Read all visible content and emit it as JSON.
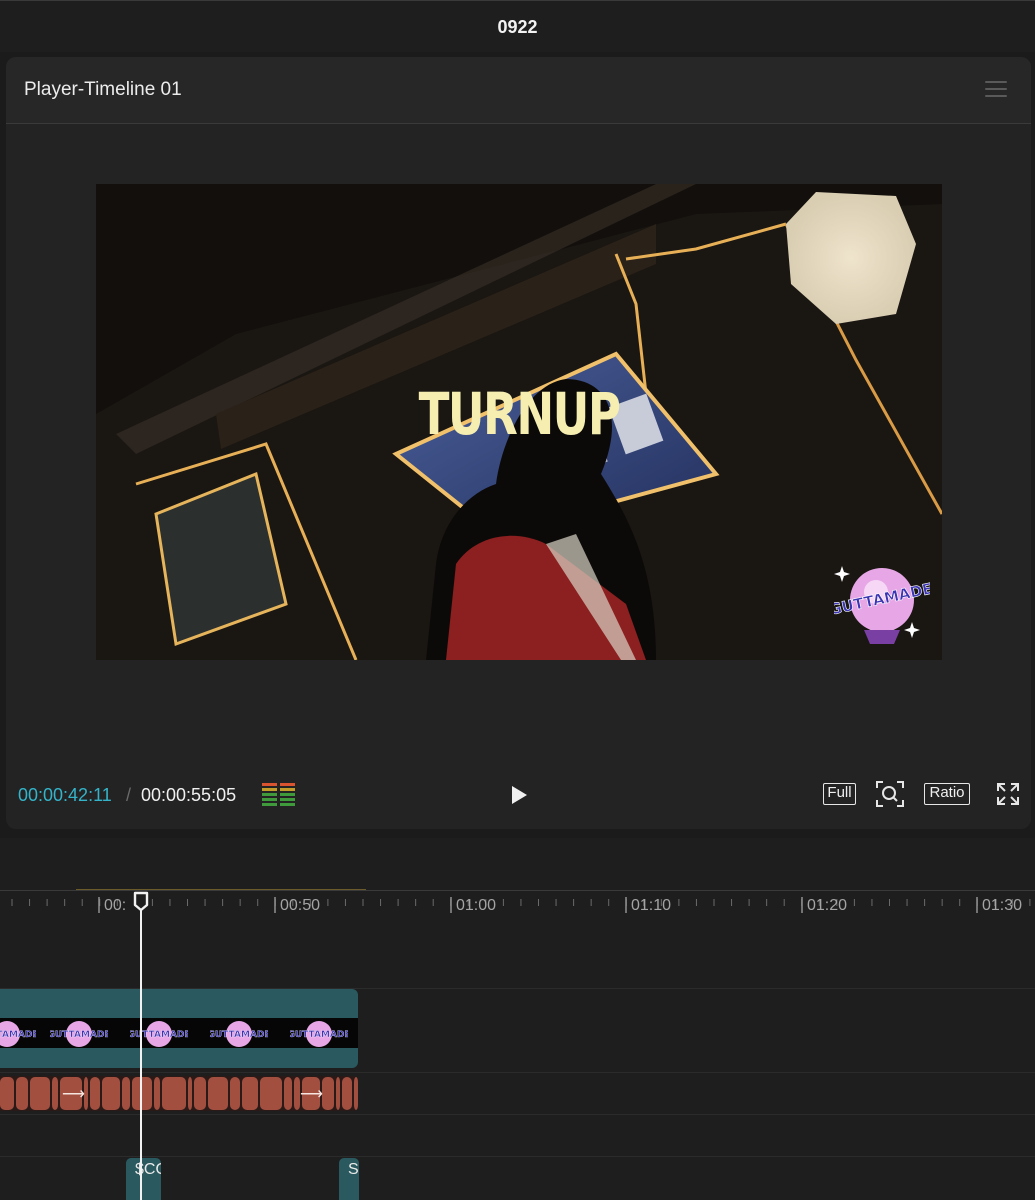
{
  "window": {
    "title": "0922"
  },
  "player": {
    "title": "Player-Timeline 01",
    "overlay_text": "TURNUP",
    "logo_text": "GUTTAMADE",
    "timecode_current": "00:00:42:11",
    "timecode_separator": "/",
    "timecode_total": "00:00:55:05",
    "buttons": {
      "full": "Full",
      "ratio": "Ratio"
    },
    "colors": {
      "timecode_accent": "#34b4c9",
      "overlay_text": "#f5eeb0"
    },
    "icons": [
      "menu-icon",
      "audio-meter-icon",
      "play-icon",
      "zoom-fit-icon",
      "fullscreen-icon"
    ]
  },
  "timeline": {
    "ruler_labels": [
      "00:",
      "00:50",
      "01:00",
      "01:10",
      "01:20",
      "01:30"
    ],
    "tracks": {
      "video_main": {
        "thumbnail_label": "GUTTAMADE"
      },
      "clip_a": {
        "label": "$CO"
      },
      "clip_b": {
        "label": "S"
      }
    },
    "colors": {
      "video_clip": "#2a5a5f",
      "audio_clip": "#a34f40"
    }
  }
}
